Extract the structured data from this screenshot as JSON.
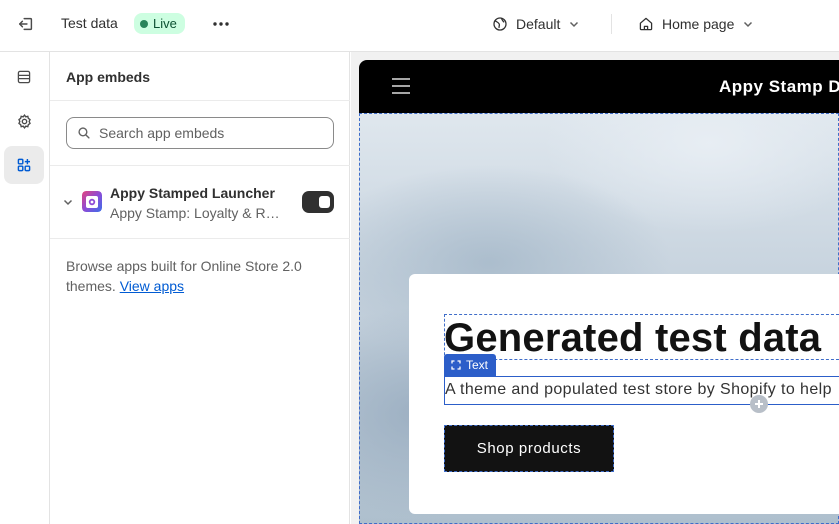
{
  "topbar": {
    "theme_name": "Test data",
    "live_badge": "Live",
    "template_select": "Default",
    "page_select": "Home page"
  },
  "rail": {
    "items": [
      {
        "name": "sections",
        "icon": "sections-icon"
      },
      {
        "name": "settings",
        "icon": "gear-icon"
      },
      {
        "name": "app-embeds",
        "icon": "apps-icon",
        "active": true
      }
    ]
  },
  "panel": {
    "title": "App embeds",
    "search_placeholder": "Search app embeds",
    "apps": [
      {
        "name": "Appy Stamped Launcher",
        "subtitle": "Appy Stamp: Loyalty & Re...",
        "enabled": true
      }
    ],
    "browse_text": "Browse apps built for Online Store 2.0 themes.",
    "browse_link": "View apps"
  },
  "preview": {
    "store_title": "Appy Stamp De",
    "hero_heading": "Generated test data",
    "hero_subtext": "A theme and populated test store by Shopify to help",
    "selection_label": "Text",
    "button_label": "Shop products"
  },
  "colors": {
    "accent": "#005bd3",
    "live_bg": "#cdfee1",
    "live_dot": "#29845a",
    "selection": "#2c5ec9"
  }
}
